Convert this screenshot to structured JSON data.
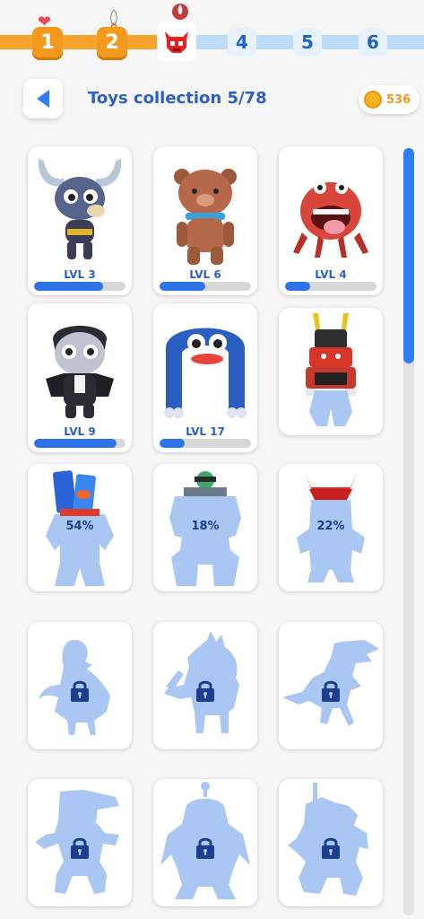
{
  "progress": {
    "nodes": [
      {
        "label": "1",
        "state": "done",
        "icon": "heart-icon"
      },
      {
        "label": "2",
        "state": "done",
        "icon": "rocket-icon"
      },
      {
        "label": "",
        "state": "current",
        "icon": "demon-skull-icon"
      },
      {
        "label": "4",
        "state": "future"
      },
      {
        "label": "5",
        "state": "future"
      },
      {
        "label": "6",
        "state": "future"
      }
    ],
    "colors": {
      "done": "#f39a1e",
      "future": "#bddcf8"
    }
  },
  "header": {
    "back_icon": "back-arrow-icon",
    "title": "Toys collection 5/78",
    "coins": "536"
  },
  "toys": [
    {
      "state": "unlocked",
      "name_icon": "viking-bull-toy",
      "level": "LVL 3",
      "level_progress": 0.75
    },
    {
      "state": "unlocked",
      "name_icon": "teddy-bear-toy",
      "level": "LVL 6",
      "level_progress": 0.5
    },
    {
      "state": "unlocked",
      "name_icon": "red-crab-monster-toy",
      "level": "LVL 4",
      "level_progress": 0.27
    },
    {
      "state": "unlocked",
      "name_icon": "vampire-toy",
      "level": "LVL 9",
      "level_progress": 0.9
    },
    {
      "state": "unlocked",
      "name_icon": "blue-arch-monster-toy",
      "level": "LVL 17",
      "level_progress": 0.27
    },
    {
      "state": "unlocked",
      "name_icon": "samurai-robot-toy"
    },
    {
      "state": "partial",
      "name_icon": "card-pack-robot-silhouette",
      "percent": "54%"
    },
    {
      "state": "partial",
      "name_icon": "mech-pilot-silhouette",
      "percent": "18%"
    },
    {
      "state": "partial",
      "name_icon": "red-horned-robot-silhouette",
      "percent": "22%"
    },
    {
      "state": "locked",
      "name_icon": "bird-silhouette"
    },
    {
      "state": "locked",
      "name_icon": "knight-dog-silhouette"
    },
    {
      "state": "locked",
      "name_icon": "dinosaur-silhouette"
    },
    {
      "state": "locked",
      "name_icon": "crocodile-fighter-silhouette"
    },
    {
      "state": "locked",
      "name_icon": "parrot-silhouette"
    },
    {
      "state": "locked",
      "name_icon": "dragon-rider-silhouette"
    }
  ]
}
